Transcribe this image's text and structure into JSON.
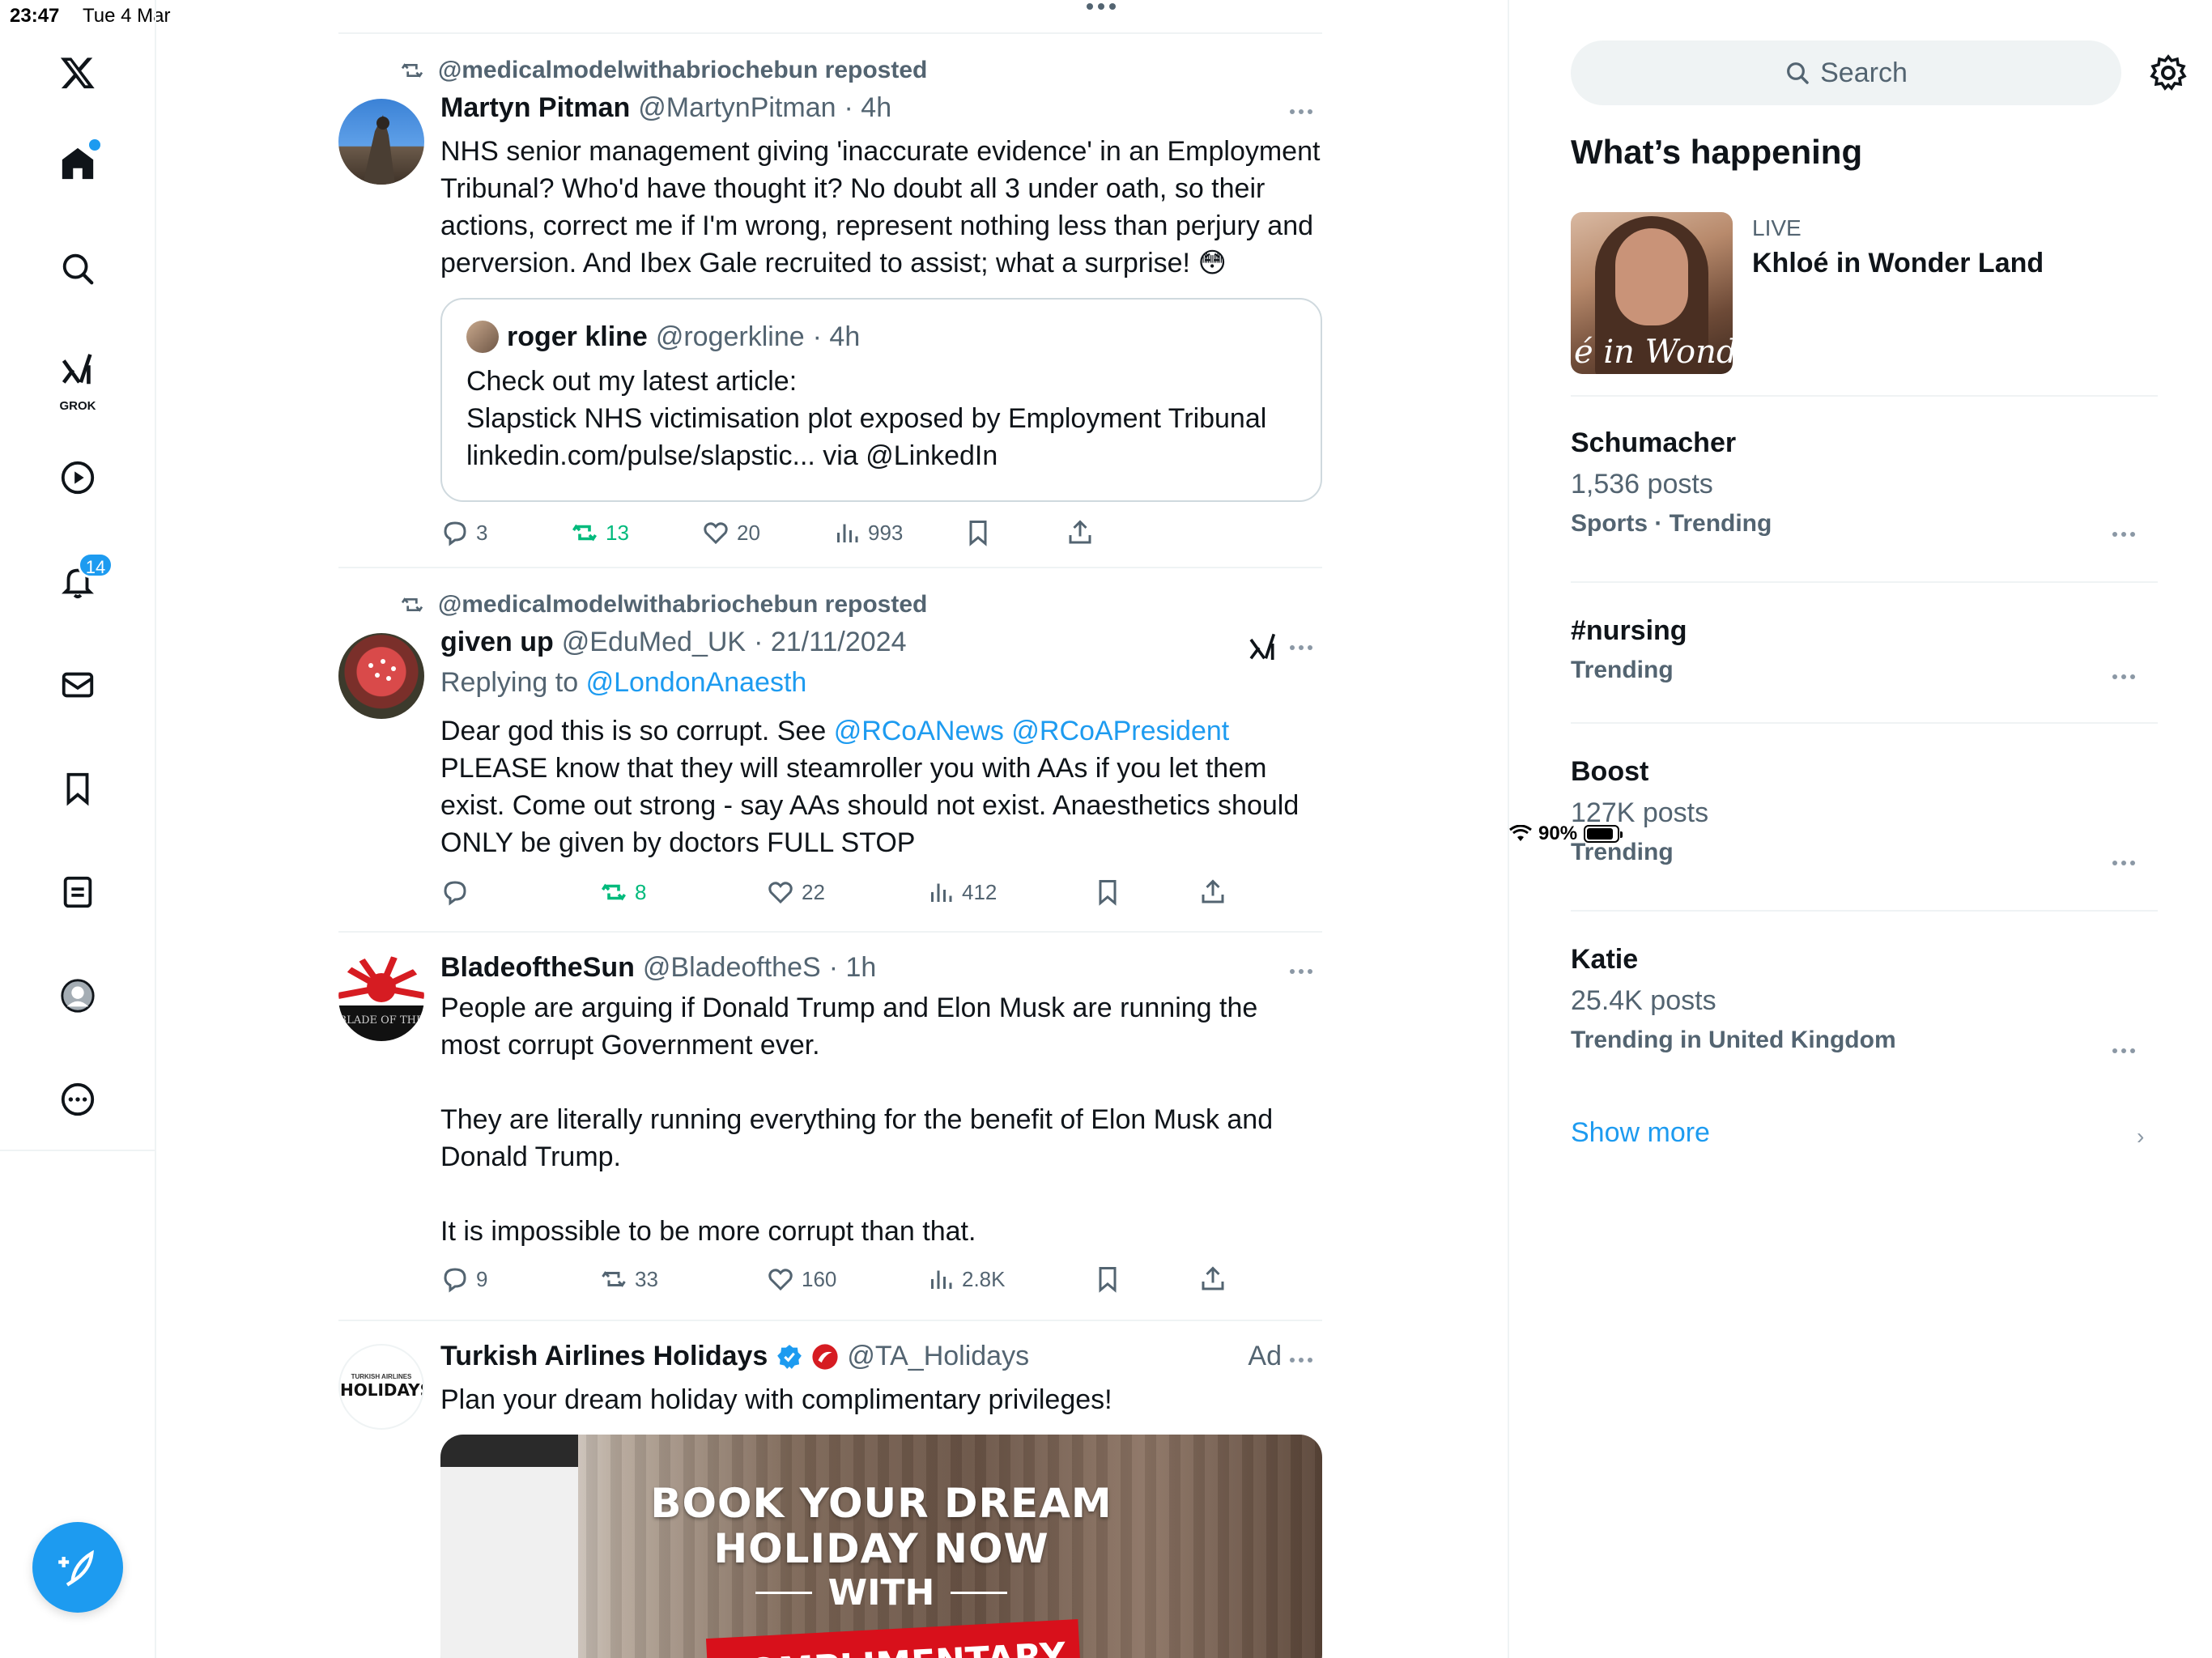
{
  "status_bar": {
    "time": "23:47",
    "date": "Tue 4 Mar",
    "battery": "90%",
    "battery_level": 0.9
  },
  "nav": {
    "grok_label": "GROK",
    "notifications_badge": "14"
  },
  "tweets": [
    {
      "repost_by": "@medicalmodelwithabriochebun reposted",
      "name": "Martyn Pitman",
      "handle": "@MartynPitman",
      "time": "· 4h",
      "text": "NHS senior management giving 'inaccurate evidence' in an Employment Tribunal? Who'd have thought it? No doubt all 3 under oath, so their actions, correct me if I'm wrong, represent nothing less than perjury and perversion. And Ibex Gale recruited to assist; what a surprise! 😳",
      "quote": {
        "name": "roger kline",
        "handle": "@rogerkline",
        "time": "· 4h",
        "line1": "Check out my latest article:",
        "line2": "Slapstick NHS victimisation plot exposed by Employment Tribunal",
        "line3": "linkedin.com/pulse/slapstic... via @LinkedIn"
      },
      "replies": "3",
      "reposts": "13",
      "likes": "20",
      "views": "993"
    },
    {
      "repost_by": "@medicalmodelwithabriochebun reposted",
      "name": "given up",
      "handle": "@EduMed_UK",
      "time": "· 21/11/2024",
      "replying_prefix": "Replying to",
      "replying_handle": "@LondonAnaesth",
      "text_before": "Dear god this is so corrupt. See",
      "mention1": "@RCoANews",
      "mention2": "@RCoAPresident",
      "text_after": "PLEASE know that they will steamroller you with AAs if you let them exist. Come out strong - say AAs should not exist. Anaesthetics should ONLY be given by doctors FULL STOP",
      "replies": "",
      "reposts": "8",
      "likes": "22",
      "views": "412"
    },
    {
      "name": "BladeoftheSun",
      "handle": "@BladeoftheS",
      "time": "· 1h",
      "para1": "People are arguing if Donald Trump and Elon Musk are running the most corrupt Government ever.",
      "para2": "They are literally running everything for the benefit of Elon Musk and Donald Trump.",
      "para3": "It is impossible to be more corrupt than that.",
      "avatar_text": "BLADE OF THE",
      "replies": "9",
      "reposts": "33",
      "likes": "160",
      "views": "2.8K"
    },
    {
      "name": "Turkish Airlines Holidays",
      "handle": "@TA_Holidays",
      "ad_label": "Ad",
      "text": "Plan your dream holiday with complimentary privileges!",
      "avatar_small": "TURKISH AIRLINES",
      "avatar_big": "HOLIDAYS",
      "image_line1": "BOOK YOUR DREAM",
      "image_line2": "HOLIDAY NOW",
      "image_line3": "WITH",
      "image_line4": "COMPLIMENTARY"
    }
  ],
  "sidebar": {
    "search_placeholder": "Search",
    "heading": "What’s happening",
    "live": {
      "label": "LIVE",
      "title": "Khloé in Wonder Land",
      "thumb_text": "é in Wonder L"
    },
    "trends": [
      {
        "name": "Schumacher",
        "count": "1,536 posts",
        "meta": "Sports · Trending"
      },
      {
        "name": "#nursing",
        "count": "",
        "meta": "Trending"
      },
      {
        "name": "Boost",
        "count": "127K posts",
        "meta": "Trending"
      },
      {
        "name": "Katie",
        "count": "25.4K posts",
        "meta": "Trending in United Kingdom"
      }
    ],
    "show_more": "Show more"
  },
  "colors": {
    "accent": "#1d9bf0",
    "repost_green": "#00ba7c",
    "secondary_text": "#536471",
    "divider": "#eff3f4"
  }
}
